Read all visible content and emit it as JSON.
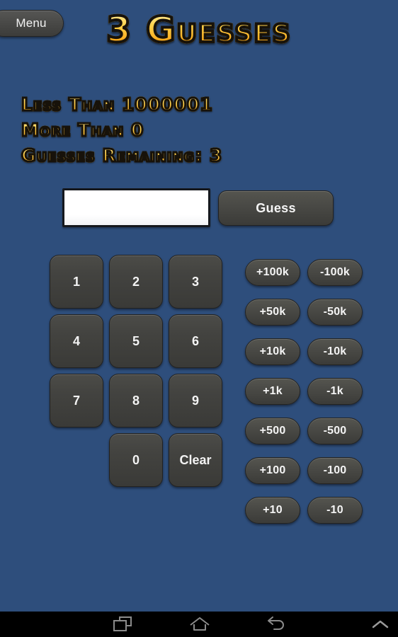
{
  "app": {
    "background_color": "#2e4e7c",
    "title": "3 Guesses"
  },
  "header": {
    "menu_label": "Menu",
    "title": "3 Guesses",
    "title_color": "#ffd24a"
  },
  "status": {
    "less_than": "Less Than 1000001",
    "more_than": "More Than 0",
    "guesses_remaining": "Guesses Remaining: 3"
  },
  "input": {
    "value": "",
    "placeholder": ""
  },
  "actions": {
    "guess_label": "Guess"
  },
  "keypad": {
    "keys": [
      {
        "label": "1",
        "name": "key-1"
      },
      {
        "label": "2",
        "name": "key-2"
      },
      {
        "label": "3",
        "name": "key-3"
      },
      {
        "label": "4",
        "name": "key-4"
      },
      {
        "label": "5",
        "name": "key-5"
      },
      {
        "label": "6",
        "name": "key-6"
      },
      {
        "label": "7",
        "name": "key-7"
      },
      {
        "label": "8",
        "name": "key-8"
      },
      {
        "label": "9",
        "name": "key-9"
      },
      {
        "label": "",
        "name": "key-blank"
      },
      {
        "label": "0",
        "name": "key-0"
      },
      {
        "label": "Clear",
        "name": "key-clear"
      }
    ]
  },
  "increments": {
    "buttons": [
      {
        "label": "+100k",
        "name": "increment-plus-100k"
      },
      {
        "label": "-100k",
        "name": "increment-minus-100k"
      },
      {
        "label": "+50k",
        "name": "increment-plus-50k"
      },
      {
        "label": "-50k",
        "name": "increment-minus-50k"
      },
      {
        "label": "+10k",
        "name": "increment-plus-10k"
      },
      {
        "label": "-10k",
        "name": "increment-minus-10k"
      },
      {
        "label": "+1k",
        "name": "increment-plus-1k"
      },
      {
        "label": "-1k",
        "name": "increment-minus-1k"
      },
      {
        "label": "+500",
        "name": "increment-plus-500"
      },
      {
        "label": "-500",
        "name": "increment-minus-500"
      },
      {
        "label": "+100",
        "name": "increment-plus-100"
      },
      {
        "label": "-100",
        "name": "increment-minus-100"
      },
      {
        "label": "+10",
        "name": "increment-plus-10"
      },
      {
        "label": "-10",
        "name": "increment-minus-10"
      }
    ]
  },
  "navbar": {
    "recents_icon": "recents-icon",
    "home_icon": "home-icon",
    "back_icon": "back-icon",
    "expand_icon": "chevron-up-icon"
  }
}
